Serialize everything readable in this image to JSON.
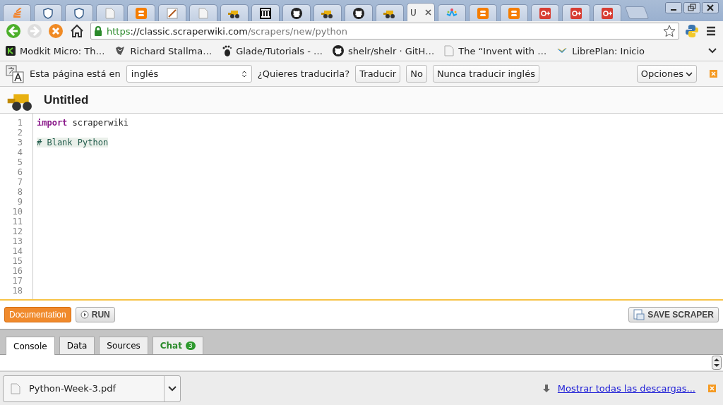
{
  "browser_tabs": [
    {
      "kind": "stack",
      "selected": false
    },
    {
      "kind": "shield",
      "selected": false
    },
    {
      "kind": "shield",
      "selected": false
    },
    {
      "kind": "page",
      "selected": false
    },
    {
      "kind": "blogger",
      "selected": false
    },
    {
      "kind": "edit",
      "selected": false
    },
    {
      "kind": "page",
      "selected": false
    },
    {
      "kind": "digger",
      "selected": false
    },
    {
      "kind": "museum",
      "selected": false
    },
    {
      "kind": "github",
      "selected": false
    },
    {
      "kind": "digger",
      "selected": false
    },
    {
      "kind": "github",
      "selected": false
    },
    {
      "kind": "digger",
      "selected": false
    },
    {
      "kind": "text",
      "title": "U",
      "selected": true
    },
    {
      "kind": "colors",
      "selected": false
    },
    {
      "kind": "blogger",
      "selected": false
    },
    {
      "kind": "blogger",
      "selected": false
    },
    {
      "kind": "gplus",
      "selected": false
    },
    {
      "kind": "gplus",
      "selected": false
    },
    {
      "kind": "gplus",
      "selected": false
    }
  ],
  "address": {
    "scheme": "https",
    "host": "://classic.scraperwiki.com",
    "path": "/scrapers/new/python"
  },
  "bookmarks": [
    {
      "kind": "k",
      "label": "Modkit Micro: Th…"
    },
    {
      "kind": "gnu",
      "label": "Richard Stallma…"
    },
    {
      "kind": "foot",
      "label": "Glade/Tutorials - …"
    },
    {
      "kind": "github",
      "label": "shelr/shelr · GitH…"
    },
    {
      "kind": "page",
      "label": "The “Invent with …"
    },
    {
      "kind": "bird",
      "label": "LibrePlan: Inicio"
    }
  ],
  "translate_bar": {
    "text": "Esta página está en",
    "language": "inglés",
    "question": "¿Quieres traducirla?",
    "buttons": [
      "Traducir",
      "No",
      "Nunca traducir inglés"
    ],
    "options": "Opciones"
  },
  "app": {
    "title": "Untitled",
    "line_numbers": [
      "1",
      "2",
      "3",
      "4",
      "5",
      "6",
      "7",
      "8",
      "9",
      "10",
      "11",
      "12",
      "13",
      "14",
      "15",
      "16",
      "17",
      "18"
    ],
    "code": [
      {
        "kind": "import",
        "keyword": "import",
        "text": " scraperwiki"
      },
      {
        "kind": "blank"
      },
      {
        "kind": "comment",
        "text": "# Blank Python",
        "highlighted": true
      }
    ],
    "documentation": "Documentation",
    "run": "RUN",
    "save": "SAVE SCRAPER",
    "panel_tabs": [
      {
        "label": "Console",
        "selected": true
      },
      {
        "label": "Data",
        "selected": false
      },
      {
        "label": "Sources",
        "selected": false
      },
      {
        "label": "Chat",
        "badge": "3",
        "selected": false
      }
    ]
  },
  "downloads": {
    "file": "Python-Week-3.pdf",
    "show_all": "Mostrar todas las descargas..."
  }
}
